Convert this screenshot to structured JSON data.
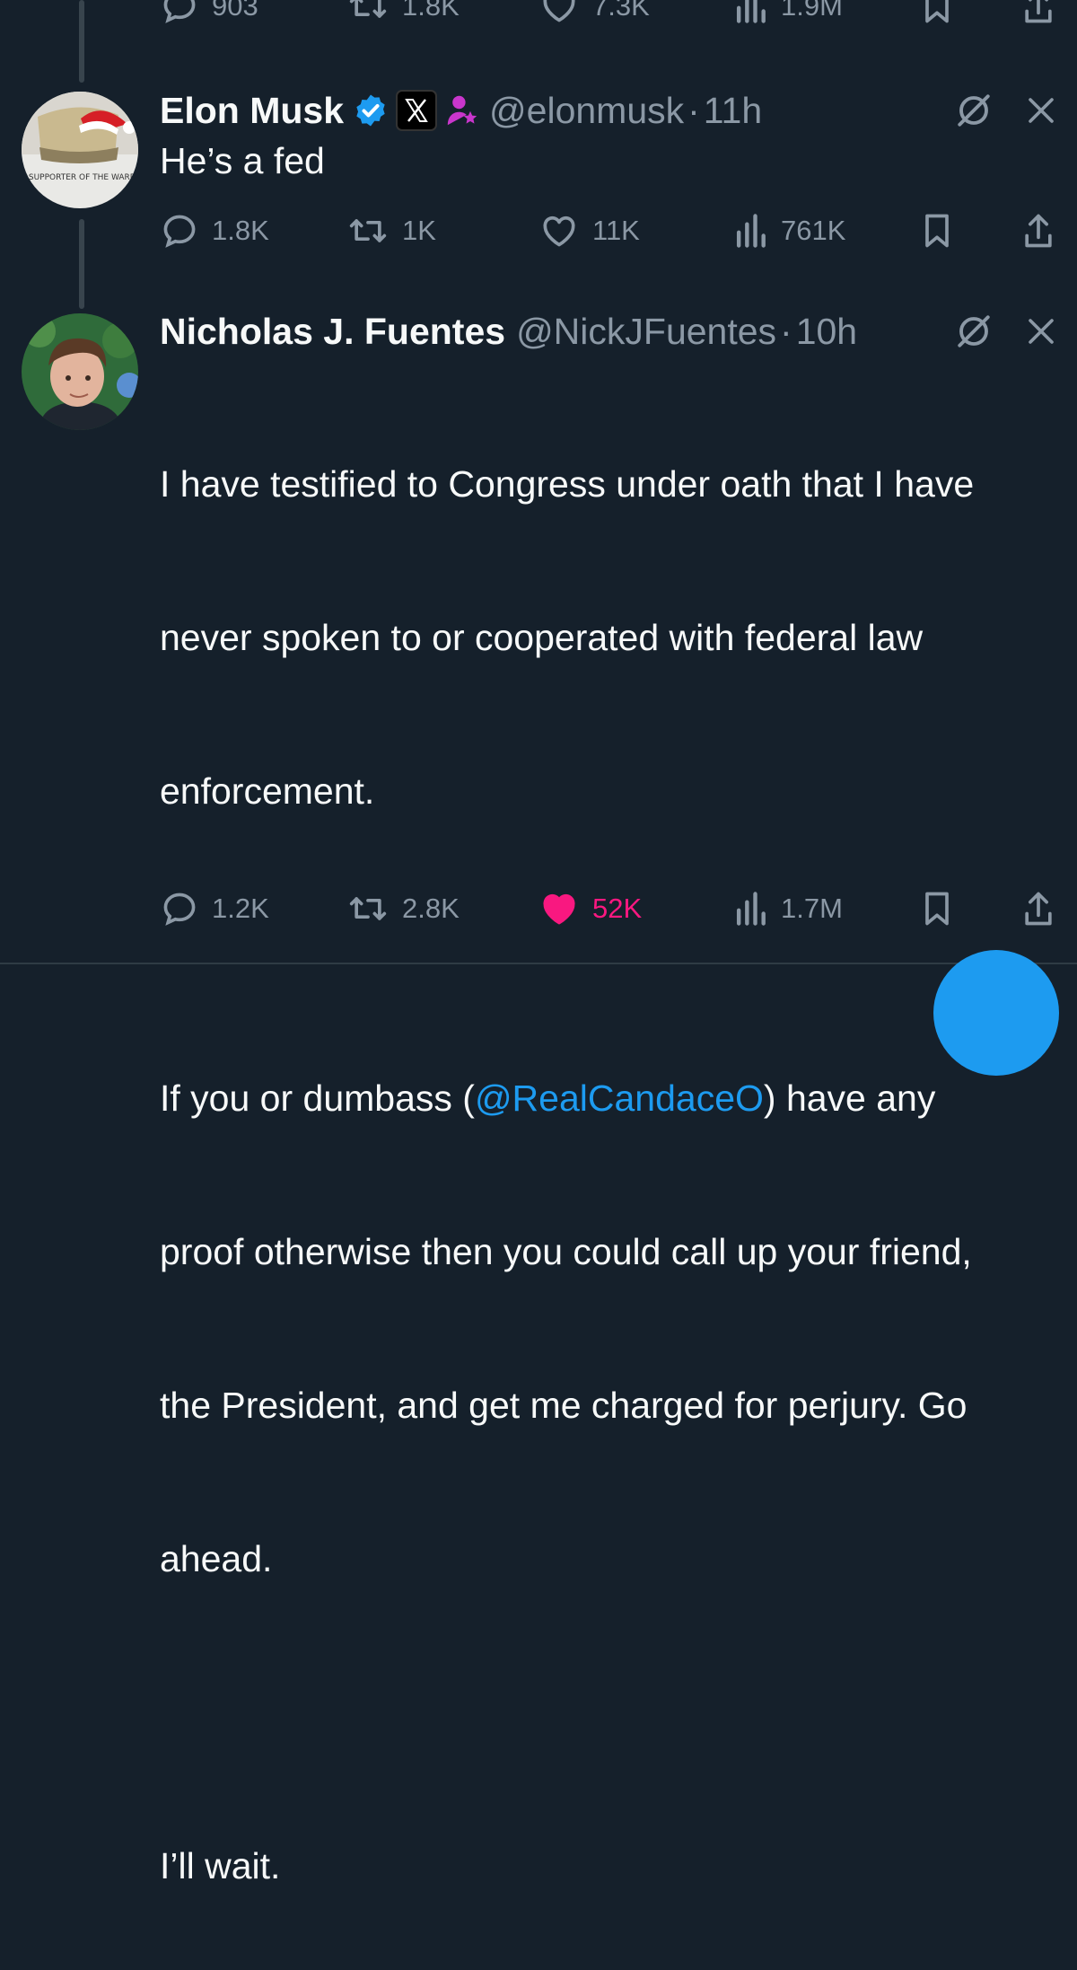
{
  "prev_tweet": {
    "stats": {
      "replies": "903",
      "reposts": "1.8K",
      "likes": "7.3K",
      "views": "1.9M"
    }
  },
  "tweet1": {
    "name": "Elon Musk",
    "handle": "@elonmusk",
    "separator": "·",
    "time": "11h",
    "text": "He’s a fed",
    "avatar_label": "TOP SUPPORTER OF THE WARRIOR",
    "stats": {
      "replies": "1.8K",
      "reposts": "1K",
      "likes": "11K",
      "views": "761K"
    }
  },
  "tweet2": {
    "name": "Nicholas J. Fuentes",
    "handle": "@NickJFuentes",
    "separator": "·",
    "time": "10h",
    "line1": "I have testified to Congress under oath that I have",
    "line2": "never spoken to or cooperated with federal law",
    "line3": "enforcement.",
    "line4_before": "If you or dumbass (",
    "mention": "@RealCandaceO",
    "line4_after": ") have any",
    "line5": "proof otherwise then you could call up your friend,",
    "line6": "the President, and get me charged for perjury. Go",
    "line7": "ahead.",
    "line8": "I’ll wait.",
    "stats": {
      "replies": "1.2K",
      "reposts": "2.8K",
      "likes": "52K",
      "views": "1.7M"
    }
  },
  "colors": {
    "background": "#15202b",
    "text": "#f7f9f9",
    "muted": "#8b98a5",
    "accent": "#1d9bf0",
    "like": "#f91880",
    "affiliate": "#c936cc"
  },
  "icons": [
    "reply-icon",
    "repost-icon",
    "like-icon",
    "views-icon",
    "bookmark-icon",
    "share-icon",
    "verified-icon",
    "x-logo-icon",
    "affiliate-icon",
    "grok-icon",
    "close-icon"
  ]
}
